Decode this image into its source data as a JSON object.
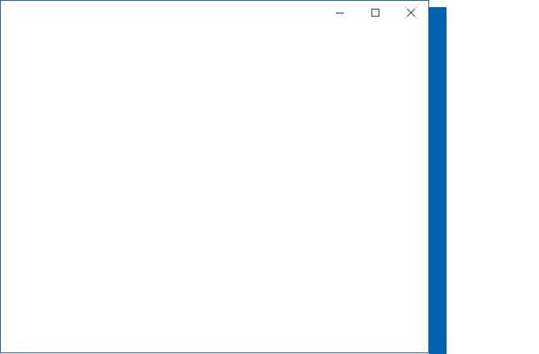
{
  "window": {
    "title": "",
    "accent_color": "#0063b1",
    "border_color": "#1e5aa0",
    "caption_buttons": [
      {
        "name": "minimize",
        "icon": "minimize-icon"
      },
      {
        "name": "maximize",
        "icon": "maximize-icon"
      },
      {
        "name": "close",
        "icon": "close-icon"
      }
    ]
  },
  "background": {
    "strip_color": "#0063b1"
  }
}
